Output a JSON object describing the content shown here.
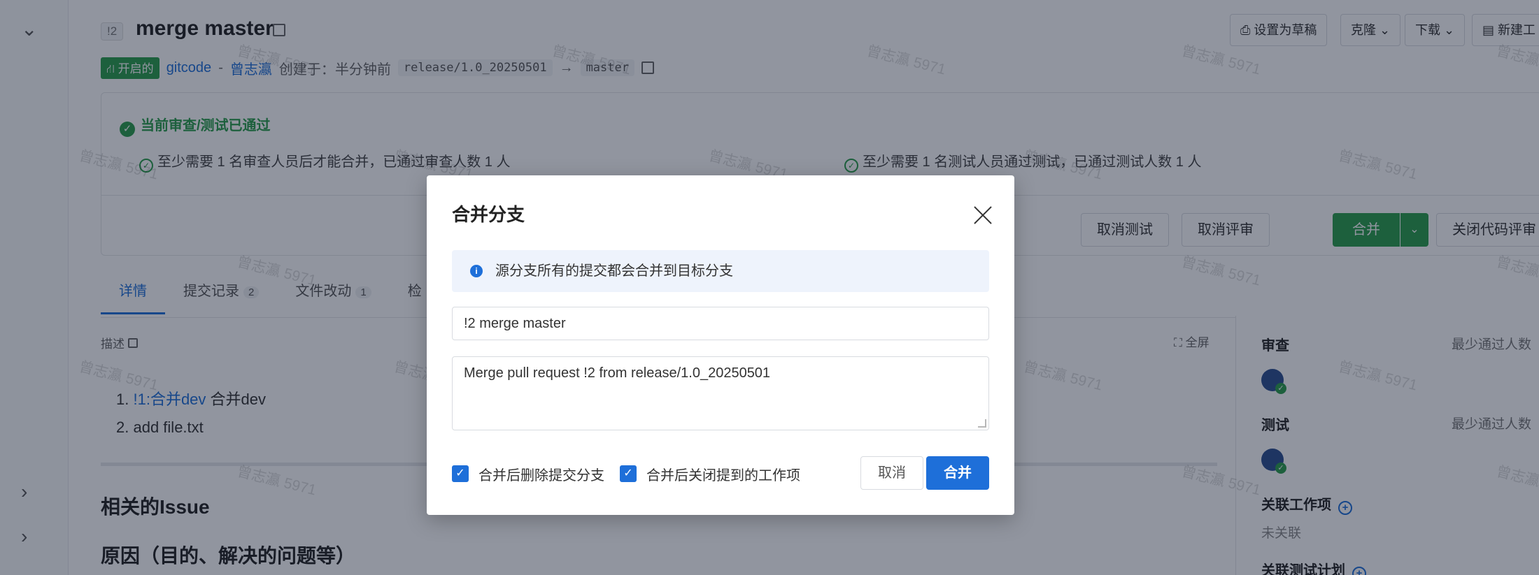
{
  "page": {
    "pr_id": "!2",
    "pr_title": "merge master",
    "status_tag": "⛙ 开启的",
    "repo": "gitcode",
    "separator": "-",
    "author": "曾志瀛",
    "created_text": "创建于：半分钟前",
    "source_branch": "release/1.0_20250501",
    "arrow": "→",
    "target_branch": "master"
  },
  "header_buttons": {
    "draft": "⎙ 设置为草稿",
    "clone": "克隆 ⌄",
    "download": "下载 ⌄",
    "new": "▤ 新建工"
  },
  "checks": {
    "title": "当前审查/测试已通过",
    "review_line": "至少需要 1 名审查人员后才能合并，已通过审查人数 1 人",
    "test_line": "至少需要 1 名测试人员通过测试，已通过测试人数 1 人"
  },
  "actions": {
    "cancel_test": "取消测试",
    "cancel_review": "取消评审",
    "merge": "合并",
    "close_pr": "关闭代码评审"
  },
  "tabs": [
    {
      "label": "详情",
      "count": ""
    },
    {
      "label": "提交记录",
      "count": "2"
    },
    {
      "label": "文件改动",
      "count": "1"
    },
    {
      "label": "检",
      "count": ""
    }
  ],
  "description": {
    "label": "描述",
    "fullscreen": "⛶ 全屏",
    "items": [
      {
        "num": "1.",
        "link": "!1:合并dev",
        "text": " 合并dev"
      },
      {
        "num": "2.",
        "link": "",
        "text": "add file.txt"
      }
    ],
    "heading1": "相关的Issue",
    "heading2": "原因（目的、解决的问题等）"
  },
  "sidebar": {
    "review_label": "审查",
    "review_min": "最少通过人数",
    "test_label": "测试",
    "test_min": "最少通过人数",
    "work_items_label": "关联工作项",
    "work_items_value": "未关联",
    "test_plan_label": "关联测试计划"
  },
  "watermark": "曾志瀛 5971",
  "dialog": {
    "title": "合并分支",
    "info": "源分支所有的提交都会合并到目标分支",
    "title_value": "!2 merge master",
    "message_value": "Merge pull request !2 from release/1.0_20250501",
    "delete_branch_label": "合并后删除提交分支",
    "close_items_label": "合并后关闭提到的工作项",
    "cancel": "取消",
    "confirm": "合并"
  },
  "icons": {
    "collapse": "chevron-down-icon",
    "expand": "chevron-right-icon",
    "check": "check-circle-icon",
    "info": "info-icon",
    "close": "close-icon"
  },
  "colors": {
    "accent_blue": "#1e6fd9",
    "success_green": "#2a9d4a",
    "overlay": "rgba(15,23,45,0.46)"
  }
}
